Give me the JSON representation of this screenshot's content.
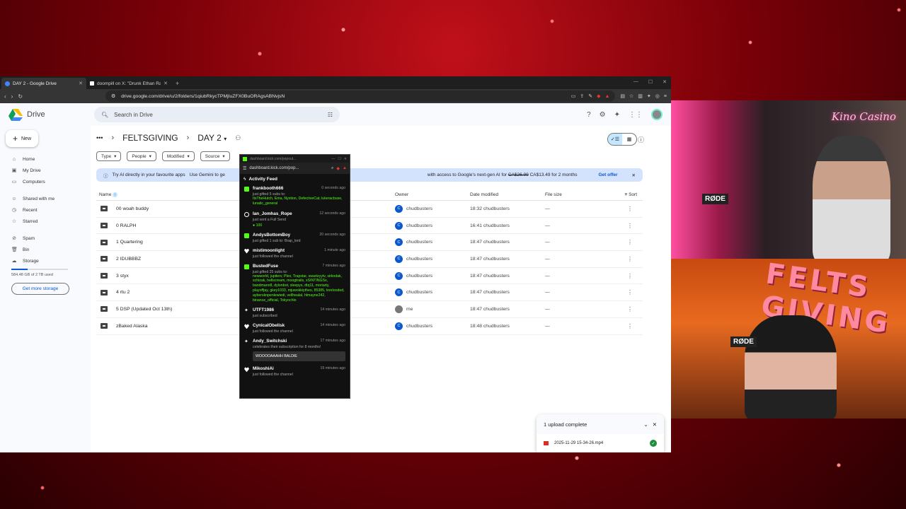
{
  "browser": {
    "tabs": [
      {
        "title": "DAY 2 - Google Drive",
        "active": true
      },
      {
        "title": "doompill on X: \"Drunk Ethan Ralph i",
        "active": false
      }
    ],
    "url": "drive.google.com/drive/u/2/folders/1qiubRkycTPMjIuZFX0BuORAgsABNvjsN"
  },
  "drive": {
    "app_name": "Drive",
    "search_placeholder": "Search in Drive",
    "new_label": "New",
    "sidebar": [
      {
        "label": "Home",
        "icon": "home-icon"
      },
      {
        "label": "My Drive",
        "icon": "drive-icon"
      },
      {
        "label": "Computers",
        "icon": "computer-icon"
      },
      {
        "label": "Shared with me",
        "icon": "people-icon"
      },
      {
        "label": "Recent",
        "icon": "clock-icon"
      },
      {
        "label": "Starred",
        "icon": "star-icon"
      },
      {
        "label": "Spam",
        "icon": "spam-icon"
      },
      {
        "label": "Bin",
        "icon": "bin-icon"
      },
      {
        "label": "Storage",
        "icon": "cloud-icon"
      }
    ],
    "storage_text": "584.48 GB of 2 TB used",
    "storage_fraction": 0.29,
    "more_storage": "Get more storage",
    "breadcrumb": {
      "parent": "FELTSGIVING",
      "current": "DAY 2"
    },
    "filters": [
      "Type",
      "People",
      "Modified",
      "Source"
    ],
    "banner": {
      "text1": "Try AI directly in your favourite apps",
      "text2": "Use Gemini to ge",
      "text3": "with access to Google's next-gen AI for",
      "old_price": "CA$26.99",
      "new_price": "CA$13.49 for 2 months",
      "cta": "Get offer"
    },
    "columns": {
      "name": "Name",
      "owner": "Owner",
      "date": "Date modified",
      "size": "File size",
      "sort": "Sort"
    },
    "files": [
      {
        "name": "00 woah buddy",
        "owner": "chudbusters",
        "owner_initial": "C",
        "date": "18:32 chudbusters",
        "size": "—"
      },
      {
        "name": "0 RALPH",
        "owner": "chudbusters",
        "owner_initial": "C",
        "date": "16:41 chudbusters",
        "size": "—"
      },
      {
        "name": "1 Quartering",
        "owner": "chudbusters",
        "owner_initial": "C",
        "date": "18:47 chudbusters",
        "size": "—"
      },
      {
        "name": "2 IDUBBBZ",
        "owner": "chudbusters",
        "owner_initial": "C",
        "date": "18:47 chudbusters",
        "size": "—"
      },
      {
        "name": "3 styx",
        "owner": "chudbusters",
        "owner_initial": "C",
        "date": "18:47 chudbusters",
        "size": "—"
      },
      {
        "name": "4 rtu 2",
        "owner": "chudbusters",
        "owner_initial": "C",
        "date": "18:47 chudbusters",
        "size": "—"
      },
      {
        "name": "5 DSP (Updated Oct 13th)",
        "owner": "me",
        "owner_initial": "",
        "date": "18:47 chudbusters",
        "size": "—"
      },
      {
        "name": "zBaked Alaska",
        "owner": "chudbusters",
        "owner_initial": "C",
        "date": "18:48 chudbusters",
        "size": "—"
      }
    ],
    "upload": {
      "title": "1 upload complete",
      "file": "2025-11-29 15-34-26.mp4"
    }
  },
  "kick_popup": {
    "title_url": "dashboard.kick.com/popout...",
    "url": "dashboard.kick.com/pop...",
    "feed_title": "Activity Feed",
    "items": [
      {
        "icon": "gift-icon",
        "user": "frankbooth666",
        "time": "0 seconds ago",
        "action": "just gifted 5 subs to:",
        "list": "ItsTheHutch, Ema, Nyxtion, DefectiveCat, lukeracbuse, lunatic_general"
      },
      {
        "icon": "tip-icon",
        "user": "Ian_Jomhas_Rope",
        "time": "12 seconds ago",
        "action": "just sent a Full Send",
        "tip": "100"
      },
      {
        "icon": "gift-icon",
        "user": "AndysBottomBoy",
        "time": "20 seconds ago",
        "action": "just gifted 1 sub to: Brap_lord"
      },
      {
        "icon": "heart-icon",
        "user": "mistimoonlight",
        "time": "1 minute ago",
        "action": "just followed the channel"
      },
      {
        "icon": "gift-icon",
        "user": "BustedFuse",
        "time": "7 minutes ago",
        "action": "just gifted 25 subs to:",
        "list": "newworld, jupiterv, Plex, Trapstar, swartzyytv, sirkodak, schizak, hellscream, moogtrails, xSINTINGSx, bandmann8, dylonbot, sleepys, dtq11, moriarty, playoffjay, gkey1033, mjuwokkiytheo, 85385, lorelooded, aybersknpenlewiedi, vellhealal, hlmayne242, binance_official, Tokyochlo"
      },
      {
        "icon": "star-icon",
        "user": "UTFT1986",
        "time": "14 minutes ago",
        "action": "just subscribed"
      },
      {
        "icon": "heart-icon",
        "user": "CynicalObelisk",
        "time": "14 minutes ago",
        "action": "just followed the channel"
      },
      {
        "icon": "star-icon",
        "user": "Andy_Switchski",
        "time": "17 minutes ago",
        "action": "celebrates their subscription for 8 months!",
        "message": "WOOOOAAAHH BALDIE"
      },
      {
        "icon": "heart-icon",
        "user": "MikoshiAi",
        "time": "19 minutes ago",
        "action": "just followed the channel"
      }
    ]
  },
  "overlay": {
    "cam_brand": "Kino Casino",
    "event_text": "FELTS GIVING",
    "mic_brand": "RØDE"
  },
  "colors": {
    "kick_green": "#53fc18",
    "drive_blue": "#0b57d0",
    "stream_red": "#9a0010"
  }
}
